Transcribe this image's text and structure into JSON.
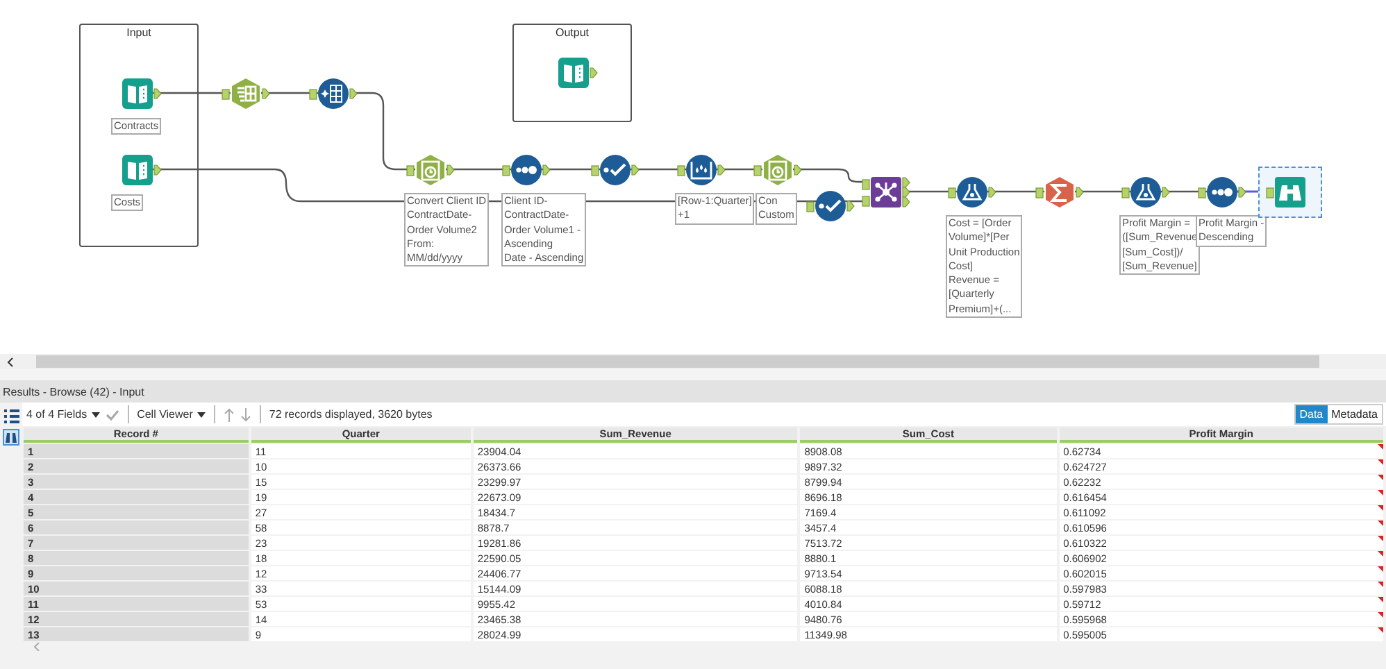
{
  "canvas": {
    "containers": [
      {
        "title": "Input"
      },
      {
        "title": "Output"
      }
    ],
    "tools": [
      {
        "kind": "input",
        "label": [
          "Contracts"
        ],
        "selected": false
      },
      {
        "kind": "input",
        "label": [
          "Costs"
        ],
        "selected": false
      },
      {
        "kind": "select",
        "selected": false
      },
      {
        "kind": "cleanse",
        "selected": false
      },
      {
        "kind": "output",
        "selected": false
      },
      {
        "kind": "datetime",
        "label": [
          "Convert Client ID",
          "ContractDate-",
          "Order Volume2",
          "From:",
          "MM/dd/yyyy"
        ],
        "selected": false
      },
      {
        "kind": "sort",
        "label": [
          "Client ID-",
          "ContractDate-",
          "Order Volume1 -",
          "Ascending",
          "Date - Ascending"
        ],
        "selected": false
      },
      {
        "kind": "check",
        "selected": false
      },
      {
        "kind": "multirow",
        "label": [
          "[Row-1:Quarter]",
          "+1"
        ],
        "selected": false
      },
      {
        "kind": "datetime",
        "label": [
          "Con",
          "Custom"
        ],
        "selected": false
      },
      {
        "kind": "check",
        "selected": false
      },
      {
        "kind": "join",
        "selected": false
      },
      {
        "kind": "formula",
        "label": [
          "Cost = [Order",
          "Volume]*[Per",
          "Unit Production",
          "Cost]",
          "Revenue =",
          "[Quarterly",
          "Premium]+(..."
        ],
        "selected": false
      },
      {
        "kind": "summarize",
        "selected": false
      },
      {
        "kind": "formula",
        "label": [
          "Profit Margin =",
          "([Sum_Revenue",
          "[Sum_Cost])/",
          "[Sum_Revenue]"
        ],
        "selected": false
      },
      {
        "kind": "sort",
        "label": [
          "Profit Margin -",
          "Descending"
        ],
        "selected": false
      },
      {
        "kind": "browse",
        "selected": true
      }
    ]
  },
  "results": {
    "title": "Results - Browse (42) - Input",
    "fields": "4 of 4 Fields",
    "viewer": "Cell Viewer",
    "info": "72 records displayed, 3620 bytes",
    "view_tabs": [
      {
        "label": "Data",
        "selected": true
      },
      {
        "label": "Metadata",
        "selected": false
      }
    ],
    "columns": [
      "Record #",
      "Quarter",
      "Sum_Revenue",
      "Sum_Cost",
      "Profit Margin"
    ],
    "rows": [
      [
        "1",
        "11",
        "23904.04",
        "8908.08",
        "0.62734"
      ],
      [
        "2",
        "10",
        "26373.66",
        "9897.32",
        "0.624727"
      ],
      [
        "3",
        "15",
        "23299.97",
        "8799.94",
        "0.62232"
      ],
      [
        "4",
        "19",
        "22673.09",
        "8696.18",
        "0.616454"
      ],
      [
        "5",
        "27",
        "18434.7",
        "7169.4",
        "0.611092"
      ],
      [
        "6",
        "58",
        "8878.7",
        "3457.4",
        "0.610596"
      ],
      [
        "7",
        "23",
        "19281.86",
        "7513.72",
        "0.610322"
      ],
      [
        "8",
        "18",
        "22590.05",
        "8880.1",
        "0.606902"
      ],
      [
        "9",
        "12",
        "24406.77",
        "9713.54",
        "0.602015"
      ],
      [
        "10",
        "33",
        "15144.09",
        "6088.18",
        "0.597983"
      ],
      [
        "11",
        "53",
        "9955.42",
        "4010.84",
        "0.59712"
      ],
      [
        "12",
        "14",
        "23465.38",
        "9480.76",
        "0.595968"
      ],
      [
        "13",
        "9",
        "28024.99",
        "11349.98",
        "0.595005"
      ]
    ]
  }
}
